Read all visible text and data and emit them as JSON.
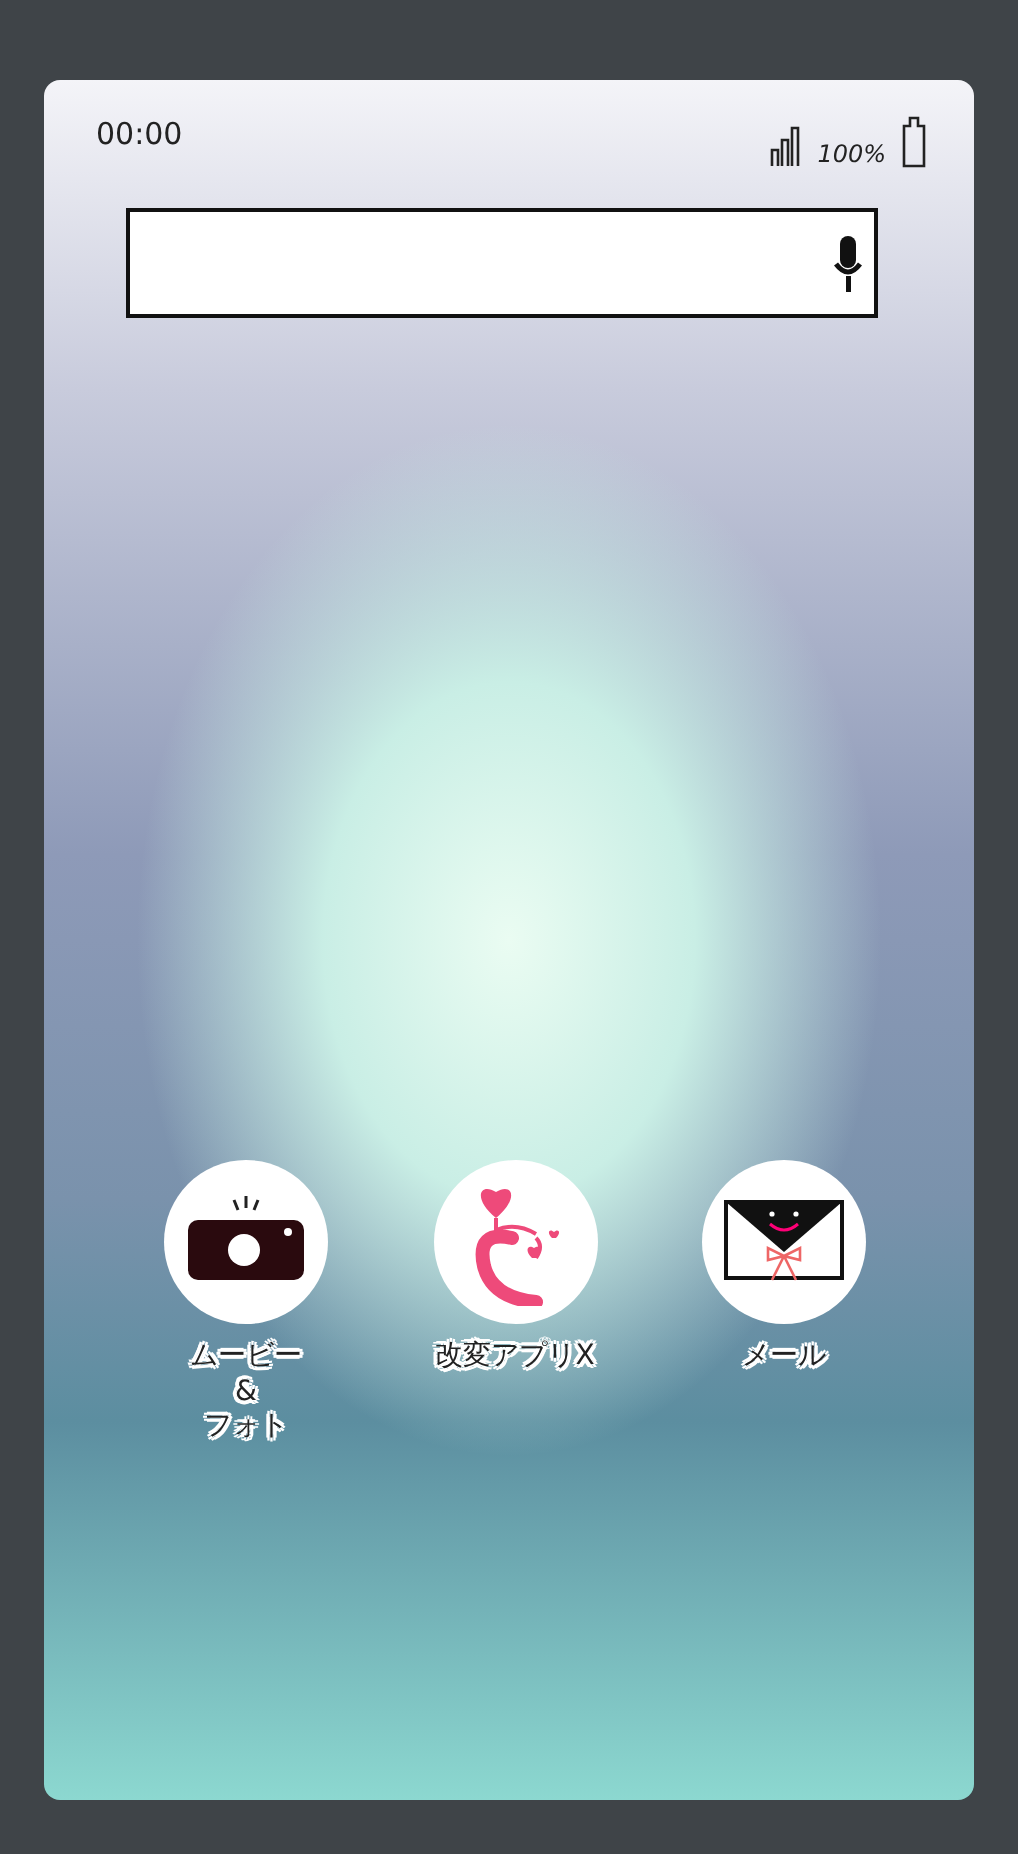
{
  "status_bar": {
    "time": "00:00",
    "battery": "100%"
  },
  "apps": [
    {
      "kind": "camera",
      "label": "ムービー\n&\nフォト"
    },
    {
      "kind": "heart",
      "label": "改変アプリX"
    },
    {
      "kind": "mail",
      "label": "メール"
    }
  ]
}
